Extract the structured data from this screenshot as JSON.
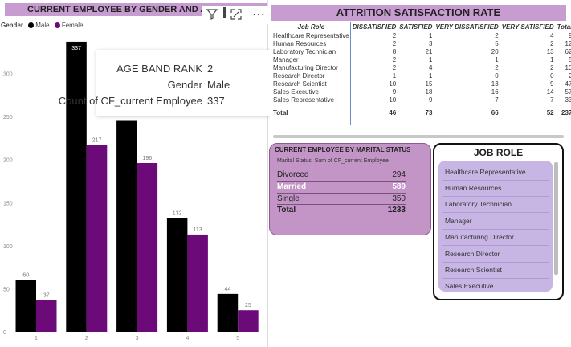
{
  "gender_chart": {
    "title": "CURRENT EMPLOYEE BY GENDER AND AG",
    "legend_title": "Gender",
    "legend": [
      {
        "name": "Male",
        "color": "#000000"
      },
      {
        "name": "Female",
        "color": "#6b0a78"
      }
    ],
    "header_icons": [
      "filter-icon",
      "focus-mode-icon",
      "more-options-icon"
    ]
  },
  "chart_data": {
    "type": "bar",
    "categories": [
      "1",
      "2",
      "3",
      "4",
      "5"
    ],
    "series": [
      {
        "name": "Male",
        "values": [
          60,
          337,
          245,
          132,
          44
        ],
        "labels": [
          "60",
          "337",
          "",
          "132",
          "44"
        ]
      },
      {
        "name": "Female",
        "values": [
          37,
          217,
          196,
          113,
          25
        ],
        "labels": [
          "37",
          "217",
          "196",
          "113",
          "25"
        ]
      }
    ],
    "ylim": [
      0,
      350
    ],
    "yticks": [
      0,
      50,
      100,
      150,
      200,
      250,
      300
    ],
    "grid": false,
    "legend_position": "top-left"
  },
  "tooltip": {
    "rows": [
      {
        "label": "AGE BAND RANK",
        "value": "2"
      },
      {
        "label": "Gender",
        "value": "Male"
      },
      {
        "label": "Count of CF_current Employee",
        "value": "337"
      }
    ]
  },
  "attrition": {
    "title": "ATTRITION SATISFACTION RATE",
    "columns": [
      "Job Role",
      "DISSATISFIED",
      "SATISFIED",
      "VERY DISSATISFIED",
      "VERY SATISFIED",
      "Total"
    ],
    "rows": [
      [
        "Healthcare Representative",
        "2",
        "1",
        "2",
        "4",
        "9"
      ],
      [
        "Human Resources",
        "2",
        "3",
        "5",
        "2",
        "12"
      ],
      [
        "Laboratory Technician",
        "8",
        "21",
        "20",
        "13",
        "62"
      ],
      [
        "Manager",
        "2",
        "1",
        "1",
        "1",
        "5"
      ],
      [
        "Manufacturing Director",
        "2",
        "4",
        "2",
        "2",
        "10"
      ],
      [
        "Research Director",
        "1",
        "1",
        "0",
        "0",
        "2"
      ],
      [
        "Research Scientist",
        "10",
        "15",
        "13",
        "9",
        "47"
      ],
      [
        "Sales Executive",
        "9",
        "18",
        "16",
        "14",
        "57"
      ],
      [
        "Sales Representative",
        "10",
        "9",
        "7",
        "7",
        "33"
      ]
    ],
    "total": [
      "Total",
      "46",
      "73",
      "66",
      "52",
      "237"
    ]
  },
  "marital": {
    "title": "CURRENT EMPLOYEE BY MARITAL STATUS",
    "col_status": "Marital Status",
    "col_sum": "Sum of CF_current Employee",
    "rows": [
      {
        "label": "Divorced",
        "value": "294"
      },
      {
        "label": "Married",
        "value": "589"
      },
      {
        "label": "Single",
        "value": "350"
      }
    ],
    "total": {
      "label": "Total",
      "value": "1233"
    }
  },
  "job_role": {
    "title": "JOB ROLE",
    "items": [
      "Healthcare Representative",
      "Human Resources",
      "Laboratory Technician",
      "Manager",
      "Manufacturing Director",
      "Research Director",
      "Research Scientist",
      "Sales Executive"
    ]
  }
}
